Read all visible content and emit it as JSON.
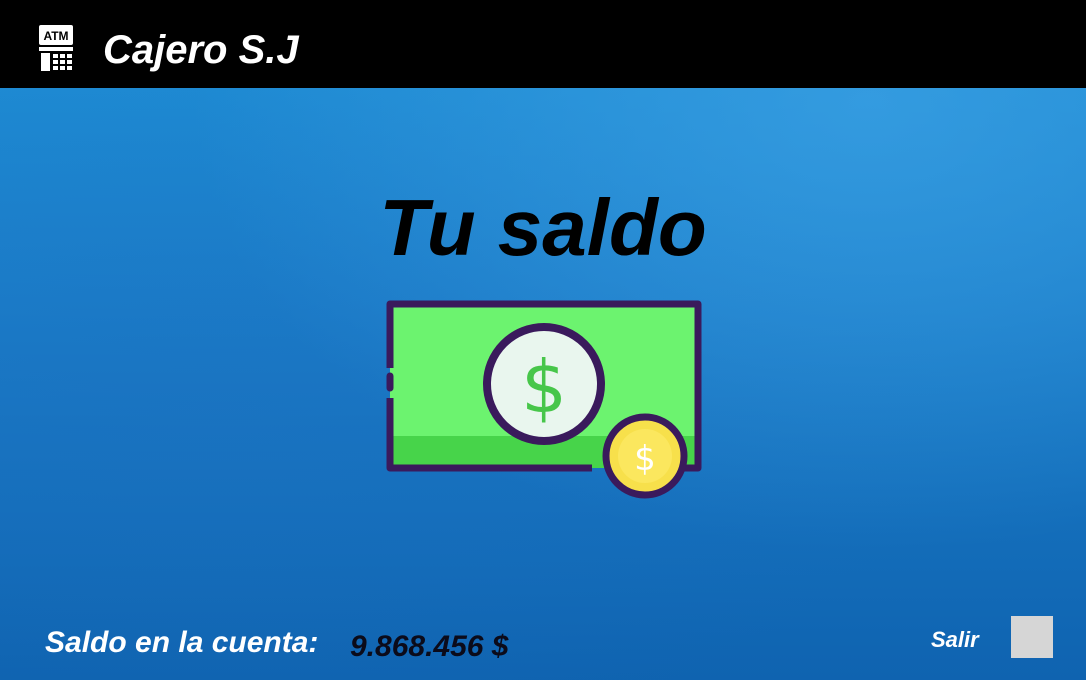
{
  "header": {
    "atm_icon_text": "ATM",
    "app_title": "Cajero S.J"
  },
  "main": {
    "heading": "Tu saldo",
    "illustration": "money-bill-with-coin-icon"
  },
  "footer": {
    "balance_label": "Saldo en la cuenta:",
    "balance_value": "9.868.456 $",
    "exit_label": "Salir"
  },
  "colors": {
    "topbar": "#000000",
    "background": "#1a7dc9",
    "bill_green": "#6cf36f",
    "bill_dark_green": "#47d44a",
    "outline": "#3a1a5c",
    "coin_yellow": "#f7e04b",
    "exit_button": "#d6d6d6"
  }
}
